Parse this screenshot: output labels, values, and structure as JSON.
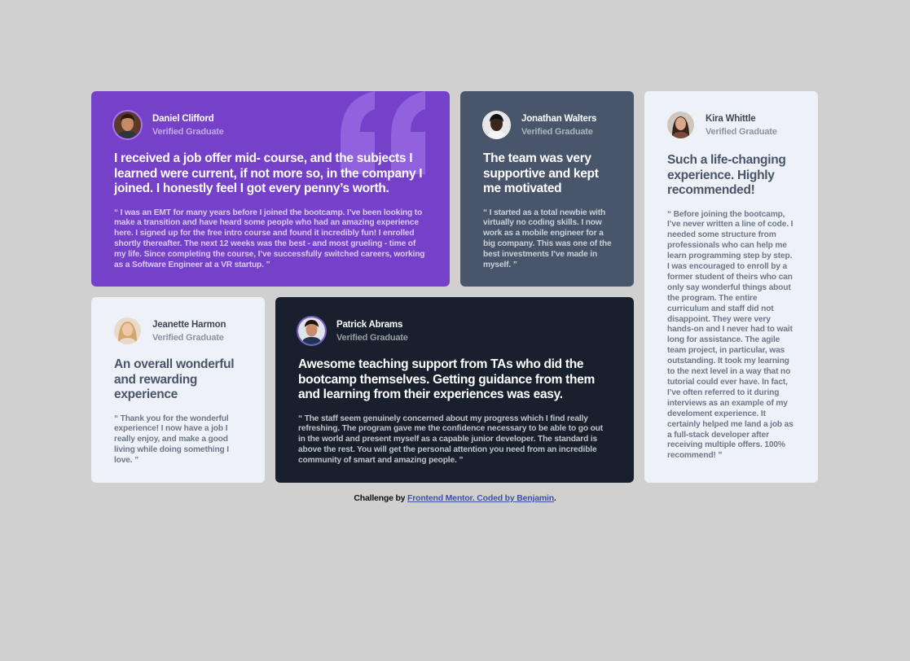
{
  "testimonials": [
    {
      "name": "Daniel Clifford",
      "role": "Verified Graduate",
      "title": "I received a job offer mid- course, and the subjects I learned were current, if not more so, in the company I joined. I honestly feel I got every penny’s worth.",
      "body": "“ I was an EMT for many years before I joined the bootcamp. I’ve been looking to make a transition and have heard some people who had an amazing experience here. I signed up for the free intro course and found it incredibly fun! I enrolled shortly thereafter. The next 12 weeks was the best - and most grueling - time of my life. Since completing the course, I’ve successfully switched careers, working as a Software Engineer at a VR startup. ”",
      "bg": "#7541c8"
    },
    {
      "name": "Jonathan Walters",
      "role": "Verified Graduate",
      "title": "The team was very supportive and kept me motivated",
      "body": "“ I started as a total newbie with virtually no coding skills. I now work as a mobile engineer for a big company. This was one of the best investments I’ve made in myself. ”",
      "bg": "#48556a"
    },
    {
      "name": "Kira Whittle",
      "role": "Verified Graduate",
      "title": "Such a life-changing experience. Highly recommended!",
      "body": "“ Before joining the bootcamp, I’ve never written a line of code. I needed some structure from professionals who can help me learn programming step by step. I was encouraged to enroll by a former student of theirs who can only say wonderful things about the program. The entire curriculum and staff did not disappoint. They were very hands-on and I never had to wait long for assistance. The agile team project, in particular, was outstanding. It took my learning to the next level in a way that no tutorial could ever have. In fact, I’ve often referred to it during interviews as an example of my develoment experience. It certainly helped me land a job as a full-stack developer after receiving multiple offers. 100% recommend! ”",
      "bg": "#eef2f8"
    },
    {
      "name": "Jeanette Harmon",
      "role": "Verified Graduate",
      "title": "An overall wonderful and rewarding experience",
      "body": "“ Thank you for the wonderful experience! I now have a job I really enjoy, and make a good living while doing something I love. ”",
      "bg": "#eef2f8"
    },
    {
      "name": "Patrick Abrams",
      "role": "Verified Graduate",
      "title": "Awesome teaching support from TAs who did the bootcamp themselves. Getting guidance from them and learning from their experiences was easy.",
      "body": "“ The staff seem genuinely concerned about my progress which I find really refreshing. The program gave me the confidence necessary to be able to go out in the world and present myself as a capable junior developer. The standard is above the rest. You will get the personal attention you need from an incredible community of smart and amazing people. ”",
      "bg": "#19202d"
    }
  ],
  "footer": {
    "prefix": "Challenge by",
    "link": "Frontend Mentor. Coded by Benjamin",
    "suffix": "."
  },
  "colors": {
    "page_bg": "#d0d0d0",
    "purple": "#7541c8",
    "grayish_blue": "#48556a",
    "dark_blue": "#19202d",
    "light_gray": "#eef2f8"
  }
}
